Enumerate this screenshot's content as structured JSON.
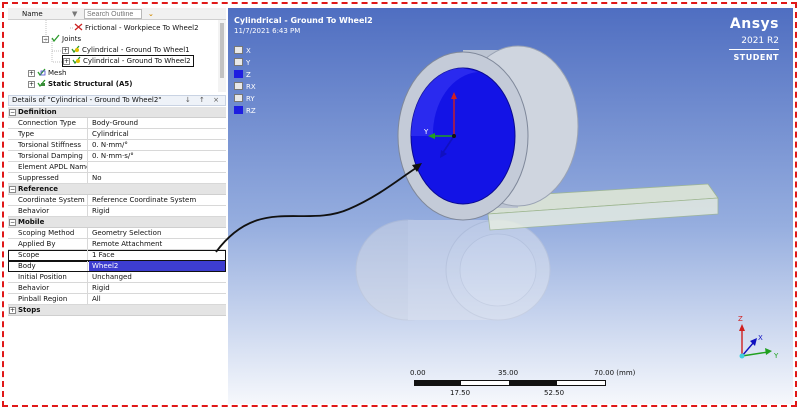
{
  "tree": {
    "header": {
      "name_label": "Name",
      "search_placeholder": "Search Outline"
    },
    "items": [
      {
        "label": "Frictional - Workpiece To Wheel2"
      },
      {
        "label": "Joints"
      },
      {
        "label": "Cylindrical - Ground To Wheel1"
      },
      {
        "label": "Cylindrical - Ground To Wheel2"
      },
      {
        "label": "Mesh"
      },
      {
        "label": "Static Structural (A5)"
      }
    ]
  },
  "details": {
    "title": "Details of \"Cylindrical - Ground To Wheel2\"",
    "controls": "↓ ↑ ×",
    "sections": [
      {
        "title": "Definition",
        "rows": [
          {
            "key": "Connection Type",
            "value": "Body-Ground"
          },
          {
            "key": "Type",
            "value": "Cylindrical"
          },
          {
            "key": "Torsional Stiffness",
            "value": "0. N·mm/°"
          },
          {
            "key": "Torsional Damping",
            "value": "0. N·mm·s/°"
          },
          {
            "key": "Element APDL Name",
            "value": ""
          },
          {
            "key": "Suppressed",
            "value": "No"
          }
        ]
      },
      {
        "title": "Reference",
        "rows": [
          {
            "key": "Coordinate System",
            "value": "Reference Coordinate System"
          },
          {
            "key": "Behavior",
            "value": "Rigid"
          }
        ]
      },
      {
        "title": "Mobile",
        "rows": [
          {
            "key": "Scoping Method",
            "value": "Geometry Selection"
          },
          {
            "key": "Applied By",
            "value": "Remote Attachment"
          },
          {
            "key": "Scope",
            "value": "1 Face"
          },
          {
            "key": "Body",
            "value": "Wheel2"
          },
          {
            "key": "Initial Position",
            "value": "Unchanged"
          },
          {
            "key": "Behavior",
            "value": "Rigid"
          },
          {
            "key": "Pinball Region",
            "value": "All"
          }
        ]
      },
      {
        "title": "Stops",
        "rows": []
      }
    ]
  },
  "viewport": {
    "title": "Cylindrical - Ground To Wheel2",
    "date": "11/7/2021 6:43 PM",
    "brand": {
      "name": "Ansys",
      "version": "2021 R2",
      "edition": "STUDENT"
    },
    "dof_legend": [
      {
        "label": "X",
        "on": false
      },
      {
        "label": "Y",
        "on": false
      },
      {
        "label": "Z",
        "on": true
      },
      {
        "label": "RX",
        "on": false
      },
      {
        "label": "RY",
        "on": false
      },
      {
        "label": "RZ",
        "on": true
      }
    ],
    "triad": {
      "x": "X",
      "y": "Y",
      "z": "Z"
    },
    "local_axis_label": "Y",
    "scale": {
      "top": [
        "0.00",
        "35.00",
        "70.00 (mm)"
      ],
      "bottom": [
        "17.50",
        "52.50"
      ]
    }
  },
  "colors": {
    "frame_dash": "#e01818",
    "highlight_blue": "#1d1de0",
    "selection": "#3d3dd0"
  }
}
